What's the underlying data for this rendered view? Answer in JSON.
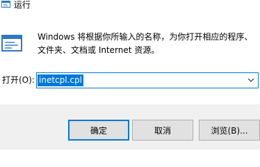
{
  "window": {
    "title": "运行"
  },
  "dialog": {
    "description_line1": "Windows 将根据你所输入的名称，为你打开相应的程序、",
    "description_line2": "文件夹、文档或 Internet 资源。"
  },
  "open": {
    "label": "打开(O):",
    "value": "inetcpl.cpl"
  },
  "buttons": {
    "ok": "确定",
    "cancel": "取消",
    "browse": "浏览(B)..."
  },
  "colors": {
    "accent": "#0078d7",
    "footer_bg": "#f0f0f0",
    "button_bg": "#e1e1e1"
  },
  "icons": {
    "title": "run-app-icon",
    "dialog": "run-dialog-icon",
    "dropdown": "chevron-down-icon"
  }
}
